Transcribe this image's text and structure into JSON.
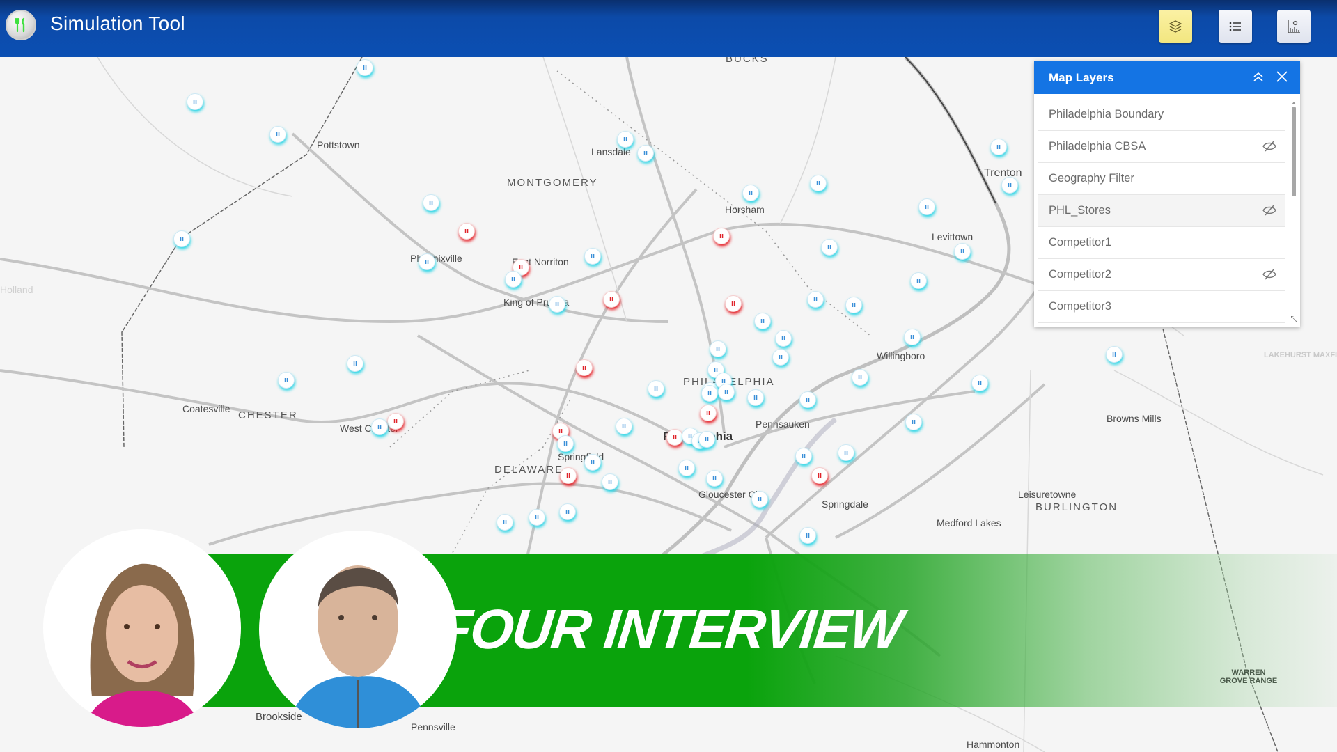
{
  "app": {
    "title": "Simulation Tool",
    "logo_icon": "fork-knife-icon"
  },
  "toolbar": {
    "buttons": [
      {
        "name": "layers",
        "icon": "layers-icon",
        "active": true
      },
      {
        "name": "legend",
        "icon": "list-icon",
        "active": false
      },
      {
        "name": "analysis",
        "icon": "chart-person-icon",
        "active": false
      }
    ],
    "active_color": "#f5ea8a"
  },
  "layers_panel": {
    "title": "Map Layers",
    "collapse_icon": "double-chevron-up-icon",
    "close_icon": "close-icon",
    "items": [
      {
        "label": "Philadelphia Boundary",
        "hidden": false,
        "selected": false
      },
      {
        "label": "Philadelphia CBSA",
        "hidden": true,
        "selected": false
      },
      {
        "label": "Geography Filter",
        "hidden": false,
        "selected": false
      },
      {
        "label": "PHL_Stores",
        "hidden": true,
        "selected": true
      },
      {
        "label": "Competitor1",
        "hidden": false,
        "selected": false
      },
      {
        "label": "Competitor2",
        "hidden": true,
        "selected": false
      },
      {
        "label": "Competitor3",
        "hidden": false,
        "selected": false
      }
    ],
    "header_color": "#1474e4"
  },
  "map": {
    "places": {
      "bucks": "BUCKS",
      "pottstown": "Pottstown",
      "lansdale": "Lansdale",
      "montgomery": "MONTGOMERY",
      "horsham": "Horsham",
      "trenton": "Trenton",
      "levittown": "Levittown",
      "phoenixville": "Phoenixville",
      "east_norriton": "East Norriton",
      "king_of_prussia": "King of Prussia",
      "willingboro": "Willingboro",
      "philadelphia_county": "PHILADELPHIA",
      "philadelphia": "Philadelphia",
      "pennsauken": "Pennsauken",
      "coatesville": "Coatesville",
      "chester": "CHESTER",
      "west_chester": "West Chester",
      "springfield": "Springfield",
      "delaware": "DELAWARE",
      "gloucester_city": "Gloucester City",
      "springdale": "Springdale",
      "browns_mills": "Browns Mills",
      "leisuretowne": "Leisuretowne",
      "burlington": "BURLINGTON",
      "medford_lakes": "Medford Lakes",
      "lakehurst": "LAKEHURST MAXFIELD FIELD",
      "warren_grove": "WARREN GROVE RANGE",
      "brookside": "Brookside",
      "pennsville": "Pennsville",
      "hammonton": "Hammonton",
      "holland": "Holland"
    },
    "store_marker_color": "#2fd6e6",
    "competitor_marker_color": "#e6232a",
    "marker_glyph": "ıı"
  },
  "overlay": {
    "banner_text": "FAST FOUR INTERVIEW",
    "banner_color": "#0aa30c",
    "guests": [
      {
        "name": "guest-woman",
        "shirt_color": "#d81b8a"
      },
      {
        "name": "guest-man",
        "shirt_color": "#2f8fd8"
      }
    ]
  }
}
